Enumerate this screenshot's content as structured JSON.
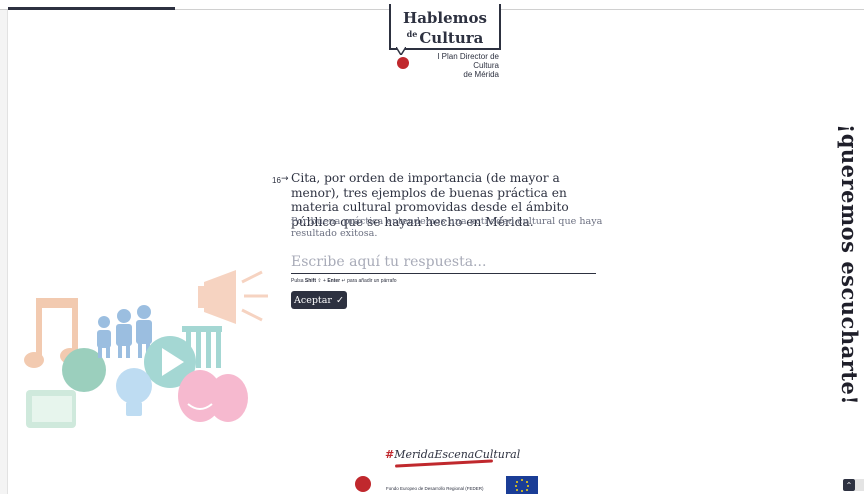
{
  "logo": {
    "line1": "Hablemos",
    "de": "de",
    "line2": "Cultura",
    "sub_line1": "I Plan Director de Cultura",
    "sub_line2": "de Mérida"
  },
  "side_banner": "¡queremos escucharte!",
  "question": {
    "number": "16",
    "text": "Cita, por orden de importancia (de mayor a menor), tres ejemplos de buenas práctica en materia cultural promovidas desde el ámbito público que se hayan hecho en Mérida.",
    "description": "Por buena práctica entendemos una actividad cultural que haya resultado exitosa."
  },
  "answer": {
    "placeholder": "Escribe aquí tu respuesta...",
    "value": ""
  },
  "hint": {
    "prefix": "Pulsa",
    "shift": "Shift",
    "plus": "+",
    "enter": "Enter",
    "suffix": "para añadir un párrafo"
  },
  "accept_button": {
    "label": "Aceptar",
    "icon": "check-icon"
  },
  "footer": {
    "hashtag": "MeridaEscenaCultural",
    "feder_text": "Fondo Europeo de Desarrollo Regional (FEDER)"
  },
  "colors": {
    "primary": "#2d3140",
    "accent_red": "#c0282d",
    "eu_blue": "#1a3d96"
  }
}
